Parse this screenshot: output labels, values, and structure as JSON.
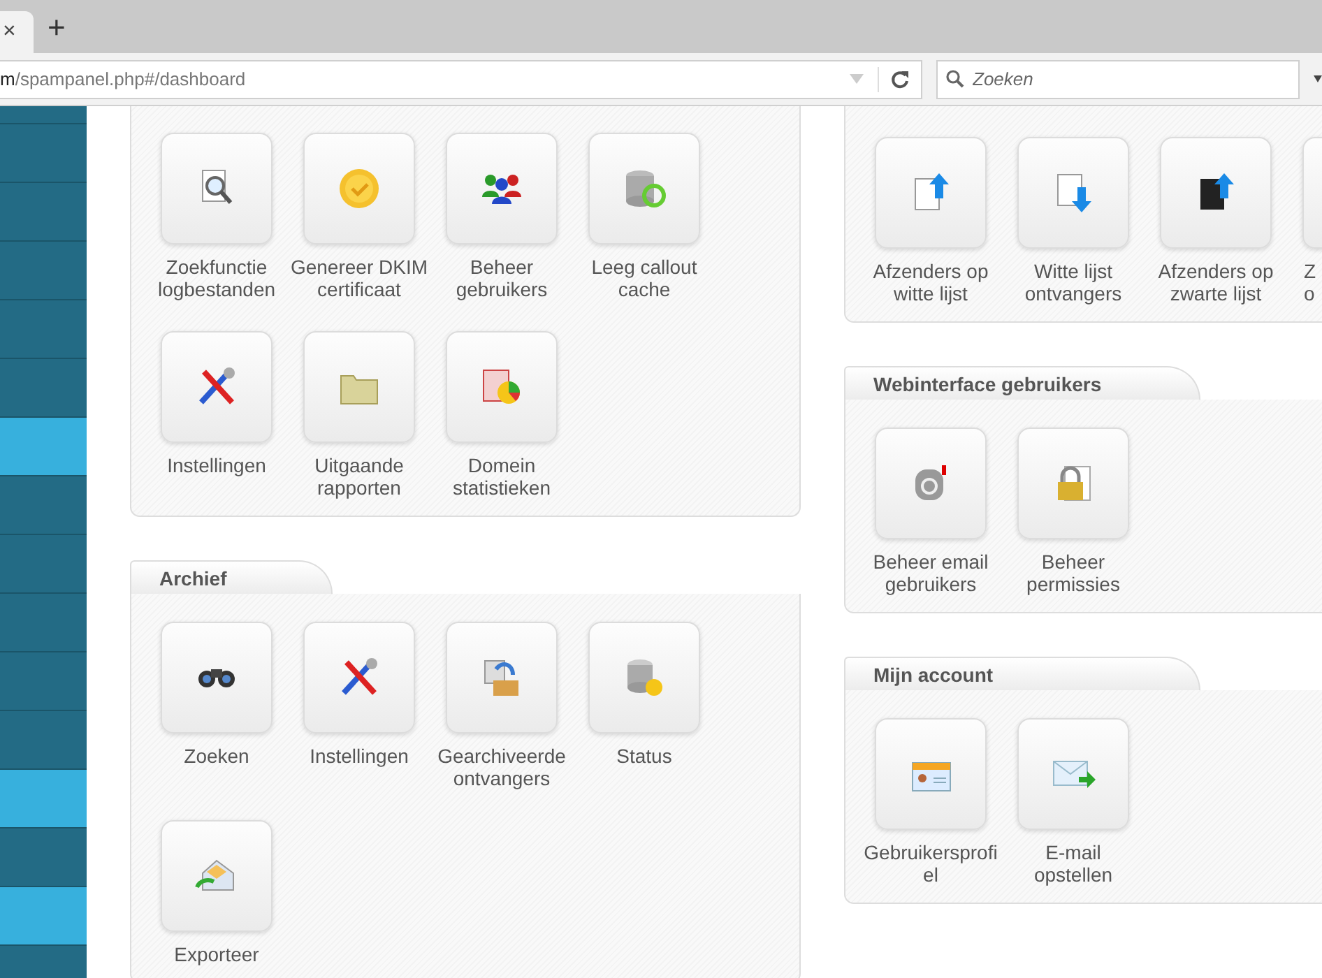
{
  "browser": {
    "tab_close": "×",
    "new_tab": "+",
    "url_host": "m",
    "url_path": "/spampanel.php#/dashboard",
    "search": {
      "placeholder": "Zoeken"
    }
  },
  "sidebar": {
    "items": [
      {
        "selected": false
      },
      {
        "selected": false
      },
      {
        "selected": false
      },
      {
        "selected": false
      },
      {
        "selected": false
      },
      {
        "selected": true
      },
      {
        "selected": false
      },
      {
        "selected": false
      },
      {
        "selected": false
      },
      {
        "selected": false
      },
      {
        "selected": false
      },
      {
        "selected": true
      },
      {
        "selected": false
      },
      {
        "selected": true
      },
      {
        "selected": false
      }
    ]
  },
  "left_column": [
    {
      "tiles": [
        {
          "lines": [
            "Zoekfunctie",
            "logbestanden"
          ]
        },
        {
          "lines": [
            "Genereer DKIM",
            "certificaat"
          ]
        },
        {
          "lines": [
            "Beheer",
            "gebruikers"
          ]
        },
        {
          "lines": [
            "Leeg callout",
            "cache"
          ]
        },
        {
          "lines": [
            "Instellingen"
          ]
        },
        {
          "lines": [
            "Uitgaande",
            "rapporten"
          ]
        },
        {
          "lines": [
            "Domein",
            "statistieken"
          ]
        }
      ]
    },
    {
      "title": "Archief",
      "tiles": [
        {
          "lines": [
            "Zoeken"
          ]
        },
        {
          "lines": [
            "Instellingen"
          ]
        },
        {
          "lines": [
            "Gearchiveerde",
            "ontvangers"
          ]
        },
        {
          "lines": [
            "Status"
          ]
        },
        {
          "lines": [
            "Exporteer"
          ]
        }
      ]
    }
  ],
  "right_column": [
    {
      "tiles": [
        {
          "lines": [
            "Afzenders op",
            "witte lijst"
          ]
        },
        {
          "lines": [
            "Witte lijst",
            "ontvangers"
          ]
        },
        {
          "lines": [
            "Afzenders op",
            "zwarte lijst"
          ]
        },
        {
          "lines": [
            "Z",
            "o"
          ],
          "kind": "partial"
        }
      ]
    },
    {
      "title": "Webinterface gebruikers",
      "tiles": [
        {
          "lines": [
            "Beheer email",
            "gebruikers"
          ]
        },
        {
          "lines": [
            "Beheer",
            "permissies"
          ]
        }
      ]
    },
    {
      "title": "Mijn account",
      "tiles": [
        {
          "lines": [
            "Gebruikersprofi",
            "el"
          ]
        },
        {
          "lines": [
            "E-mail",
            "opstellen"
          ]
        }
      ]
    }
  ]
}
